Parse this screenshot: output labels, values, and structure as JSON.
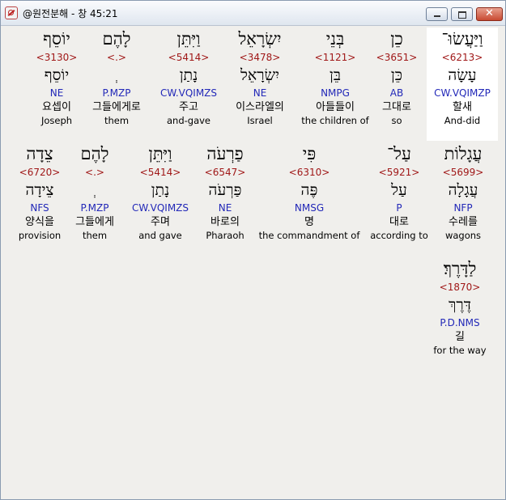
{
  "window": {
    "title": "@원전분해 - 창 45:21",
    "min_icon": "minimize-icon",
    "max_icon": "maximize-icon",
    "close_glyph": "✕"
  },
  "rows": [
    [
      {
        "heb": "וַיַּעֲשׂוּ־",
        "strong": "<6213>",
        "lemma": "עָשָׂה",
        "parse": "CW.VQIMZP",
        "kor": "할새",
        "eng": "And-did",
        "highlight": true
      },
      {
        "heb": "כֵן",
        "strong": "<3651>",
        "lemma": "כֵּן",
        "parse": "AB",
        "kor": "그대로",
        "eng": "so"
      },
      {
        "heb": "בְּנֵי",
        "strong": "<1121>",
        "lemma": "בֵּן",
        "parse": "NMPG",
        "kor": "아들들이",
        "eng": "the children of"
      },
      {
        "heb": "יִשְׂרָאֵל",
        "strong": "<3478>",
        "lemma": "יִשְׂרָאֵל",
        "parse": "NE",
        "kor": "이스라엘의",
        "eng": "Israel"
      },
      {
        "heb": "וַיִּתֵּן",
        "strong": "<5414>",
        "lemma": "נָתַן",
        "parse": "CW.VQIMZS",
        "kor": "주고",
        "eng": "and-gave"
      },
      {
        "heb": "לָהֶם",
        "strong": "<.>",
        "lemma": "ְ",
        "parse": "P.MZP",
        "kor": "그들에게로",
        "eng": "them"
      },
      {
        "heb": "יוֹסֵף",
        "strong": "<3130>",
        "lemma": "יוֹסֵף",
        "parse": "NE",
        "kor": "요셉이",
        "eng": "Joseph"
      }
    ],
    [
      {
        "heb": "עֲגָלוֹת",
        "strong": "<5699>",
        "lemma": "עֲגָלָה",
        "parse": "NFP",
        "kor": "수레를",
        "eng": "wagons"
      },
      {
        "heb": "עַל־",
        "strong": "<5921>",
        "lemma": "עַל",
        "parse": "P",
        "kor": "대로",
        "eng": "according to"
      },
      {
        "heb": "פִּי",
        "strong": "<6310>",
        "lemma": "פֶּה",
        "parse": "NMSG",
        "kor": "명",
        "eng": "the commandment of"
      },
      {
        "heb": "פַרְעֹה",
        "strong": "<6547>",
        "lemma": "פַּרְעֹה",
        "parse": "NE",
        "kor": "바로의",
        "eng": "Pharaoh"
      },
      {
        "heb": "וַיִּתֵּן",
        "strong": "<5414>",
        "lemma": "נָתַן",
        "parse": "CW.VQIMZS",
        "kor": "주며",
        "eng": "and gave"
      },
      {
        "heb": "לָהֶם",
        "strong": "<.>",
        "lemma": "ְ",
        "parse": "P.MZP",
        "kor": "그들에게",
        "eng": "them"
      },
      {
        "heb": "צֵדָה",
        "strong": "<6720>",
        "lemma": "צֵידָה",
        "parse": "NFS",
        "kor": "양식을",
        "eng": "provision"
      }
    ],
    [
      {
        "heb": "לַדָּרֶךְ׃",
        "strong": "<1870>",
        "lemma": "דֶּרֶךְ",
        "parse": "P.D.NMS",
        "kor": "길",
        "eng": "for the way"
      }
    ]
  ]
}
